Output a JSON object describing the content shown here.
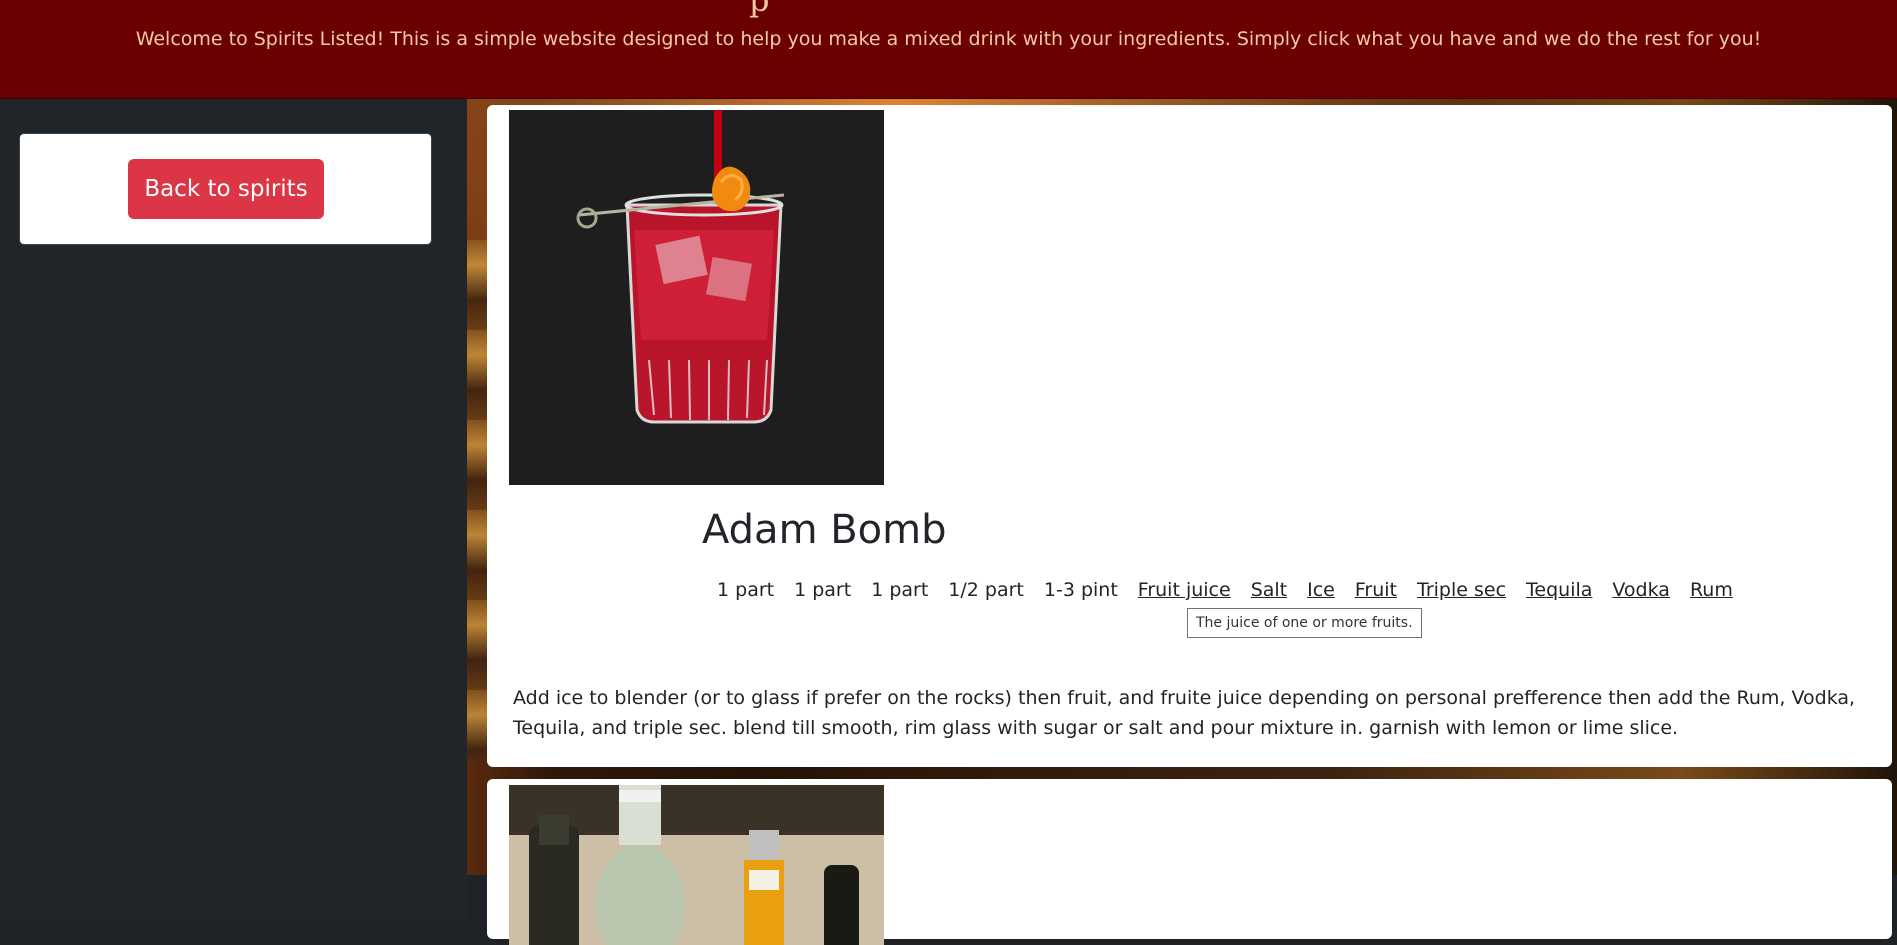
{
  "header": {
    "title_fragment": "p",
    "subtitle": "Welcome to Spirits Listed! This is a simple website designed to help you make a mixed drink with your ingredients. Simply click what you have and we do the rest for you!"
  },
  "sidebar": {
    "back_button_label": "Back to spirits"
  },
  "drinks": [
    {
      "name": "Adam Bomb",
      "image_icon": "cocktail-glass-photo",
      "measures": [
        "1 part",
        "1 part",
        "1 part",
        "1/2 part",
        "1-3 pint"
      ],
      "ingredients": [
        "Fruit juice",
        "Salt",
        "Ice",
        "Fruit",
        "Triple sec",
        "Tequila",
        "Vodka",
        "Rum"
      ],
      "tooltip": "The juice of one or more fruits.",
      "instructions": "Add ice to blender (or to glass if prefer on the rocks) then fruit, and fruite juice depending on personal prefference then add the Rum, Vodka, Tequila, and triple sec. blend till smooth, rim glass with sugar or salt and pour mixture in. garnish with lemon or lime slice."
    },
    {
      "image_icon": "liquor-bottles-photo"
    }
  ],
  "colors": {
    "header_bg": "#6a0000",
    "header_text": "#f5c9a3",
    "sidebar_bg": "#20252a",
    "button_bg": "#dc3545",
    "card_bg": "#ffffff"
  }
}
